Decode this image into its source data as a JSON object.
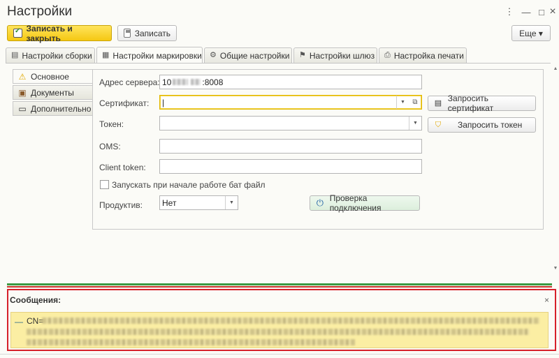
{
  "window": {
    "title": "Настройки",
    "menu_icon": "⋮",
    "minimize_icon": "—",
    "maximize_icon": "□",
    "close_icon": "×"
  },
  "toolbar": {
    "save_close_label": "Записать и закрыть",
    "save_label": "Записать",
    "more_label": "Еще ▾"
  },
  "tabs": [
    {
      "label": "Настройки сборки",
      "icon": "build-settings-icon",
      "glyph": "▤"
    },
    {
      "label": "Настройки маркировки",
      "icon": "qr-code-icon",
      "glyph": "▦"
    },
    {
      "label": "Общие настройки",
      "icon": "gear-icon",
      "glyph": "⚙"
    },
    {
      "label": "Настройки шлюз",
      "icon": "gateway-icon",
      "glyph": "⚑"
    },
    {
      "label": "Настройка печати",
      "icon": "printer-icon",
      "glyph": "⎙"
    }
  ],
  "side_nav": [
    {
      "label": "Основное",
      "icon": "warning-icon",
      "glyph": "⚠"
    },
    {
      "label": "Документы",
      "icon": "briefcase-icon",
      "glyph": "▣"
    },
    {
      "label": "Дополнительно",
      "icon": "comment-icon",
      "glyph": "▭"
    }
  ],
  "form": {
    "server_label": "Адрес сервера:",
    "server_prefix": "10",
    "server_suffix": ":8008",
    "certificate_label": "Сертификат:",
    "certificate_value": "|",
    "token_label": "Токен:",
    "token_value": "",
    "oms_label": "OMS:",
    "oms_value": "",
    "client_token_label": "Client token:",
    "client_token_value": "",
    "run_bat_label": "Запускать при начале работе бат файл",
    "productive_label": "Продуктив:",
    "productive_value": "Нет",
    "request_cert_label": "Запросить сертификат",
    "request_token_label": "Запросить токен",
    "check_connection_label": "Проверка подключения"
  },
  "messages": {
    "title": "Сообщения:",
    "close_icon": "×",
    "dash": "—",
    "cn_prefix": "CN="
  }
}
